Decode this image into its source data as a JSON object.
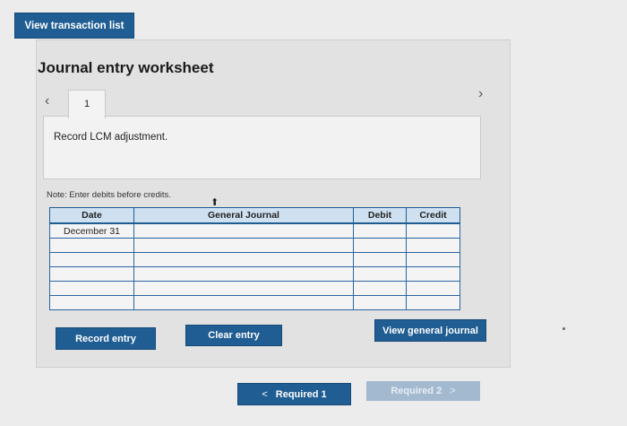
{
  "top_button": {
    "label": "View transaction list"
  },
  "worksheet": {
    "title": "Journal entry worksheet",
    "prev_icon": "chevron-left-icon",
    "next_icon": "chevron-right-icon",
    "current_tab": "1",
    "description": "Record LCM adjustment.",
    "note": "Note: Enter debits before credits."
  },
  "table": {
    "headers": {
      "date": "Date",
      "general_journal": "General Journal",
      "debit": "Debit",
      "credit": "Credit"
    },
    "rows": [
      {
        "date": "December 31",
        "account": "",
        "debit": "",
        "credit": ""
      },
      {
        "date": "",
        "account": "",
        "debit": "",
        "credit": ""
      },
      {
        "date": "",
        "account": "",
        "debit": "",
        "credit": ""
      },
      {
        "date": "",
        "account": "",
        "debit": "",
        "credit": ""
      },
      {
        "date": "",
        "account": "",
        "debit": "",
        "credit": ""
      },
      {
        "date": "",
        "account": "",
        "debit": "",
        "credit": ""
      }
    ]
  },
  "actions": {
    "record_entry": "Record entry",
    "clear_entry": "Clear entry",
    "view_general_journal": "View general journal"
  },
  "nav": {
    "required1": "Required 1",
    "required2": "Required 2",
    "prev_symbol": "<",
    "next_symbol": ">"
  },
  "colors": {
    "primary": "#1f5d93",
    "header_bg": "#cfe0f1",
    "disabled": "#a3b9cf"
  }
}
